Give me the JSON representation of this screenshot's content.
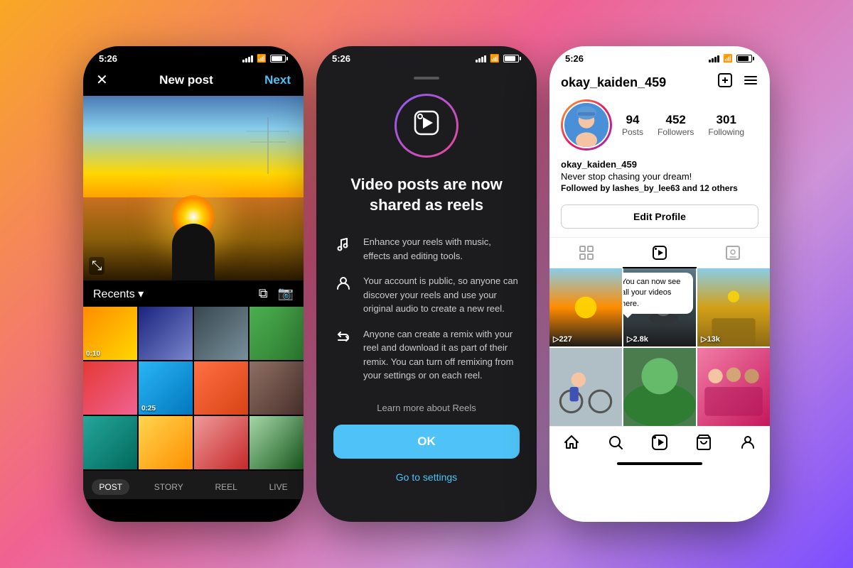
{
  "background": "linear-gradient(135deg, #f9a825 0%, #f06292 40%, #ce93d8 70%, #7c4dff 100%)",
  "phone1": {
    "status_time": "5:26",
    "header_title": "New post",
    "header_next": "Next",
    "gallery_label": "Recents",
    "gallery_arrow": "▾",
    "tabs": [
      "POST",
      "STORY",
      "REEL",
      "LIVE"
    ],
    "active_tab": "POST",
    "thumb_durations": [
      "0:10",
      "",
      "",
      "",
      "",
      "0:25",
      "",
      "",
      "",
      "",
      "",
      ""
    ]
  },
  "phone2": {
    "status_time": "5:26",
    "main_title": "Video posts are now shared as reels",
    "features": [
      {
        "icon": "♪",
        "text": "Enhance your reels with music, effects and editing tools."
      },
      {
        "icon": "☺",
        "text": "Your account is public, so anyone can discover your reels and use your original audio to create a new reel."
      },
      {
        "icon": "⟳",
        "text": "Anyone can create a remix with your reel and download it as part of their remix. You can turn off remixing from your settings or on each reel."
      }
    ],
    "learn_more": "Learn more about Reels",
    "ok_button": "OK",
    "go_settings": "Go to settings"
  },
  "phone3": {
    "status_time": "5:26",
    "username": "okay_kaiden_459",
    "stats": {
      "posts_num": "94",
      "posts_label": "Posts",
      "followers_num": "452",
      "followers_label": "Followers",
      "following_num": "301",
      "following_label": "Following"
    },
    "bio_name": "okay_kaiden_459",
    "bio_text": "Never stop chasing your dream!",
    "bio_followed_prefix": "Followed by ",
    "bio_followed_name1": "lashes_by_lee63",
    "bio_followed_suffix": " and ",
    "bio_followed_others": "12 others",
    "edit_profile_label": "Edit Profile",
    "tooltip_text": "You can now see all your videos here.",
    "video_counts": [
      "▷227",
      "▷2.8k",
      "▷13k",
      "",
      "",
      ""
    ],
    "bottom_nav_icons": [
      "⌂",
      "⌕",
      "▶",
      "🛍",
      "👤"
    ]
  }
}
